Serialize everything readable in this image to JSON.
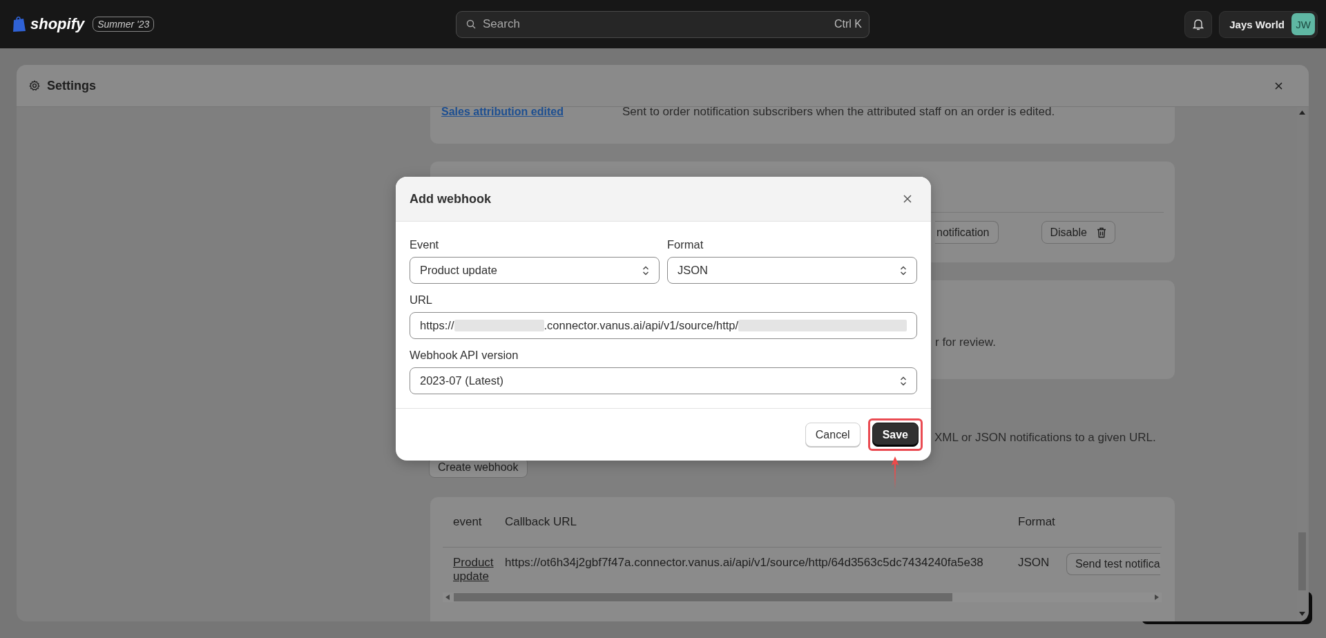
{
  "topbar": {
    "logo_text": "shopify",
    "edition_badge": "Summer '23",
    "search": {
      "placeholder": "Search",
      "shortcut": "Ctrl K"
    },
    "store": {
      "name": "Jays World",
      "initials": "JW"
    }
  },
  "settings": {
    "title": "Settings"
  },
  "background": {
    "subscription": {
      "event": "Sales attribution edited",
      "description": "Sent to order notification subscribers when the attributed staff on an order is edited."
    },
    "test_button": "notification",
    "disable_button": "Disable",
    "review_text": "r for review.",
    "webhooks_text": "XML or JSON notifications to a given URL.",
    "create_button": "Create webhook",
    "table": {
      "columns": [
        "event",
        "Callback URL",
        "Format"
      ],
      "rows": [
        {
          "event": "Product update",
          "url": "https://ot6h34j2gbf7f47a.connector.vanus.ai/api/v1/source/http/64d3563c5dc7434240fa5e38",
          "format": "JSON",
          "action": "Send test notifica"
        }
      ]
    }
  },
  "dialog": {
    "title": "Add webhook",
    "rows": [
      [
        {
          "kind": "select",
          "label": "Event",
          "value": "Product update"
        },
        {
          "kind": "select",
          "label": "Format",
          "value": "JSON"
        }
      ],
      [
        {
          "kind": "url",
          "label": "URL",
          "segments": [
            {
              "kind": "text",
              "text": "https://"
            },
            {
              "kind": "redacted"
            },
            {
              "kind": "text",
              "text": ".connector.vanus.ai/api/v1/source/http/"
            },
            {
              "kind": "redacted"
            }
          ]
        }
      ],
      [
        {
          "kind": "select",
          "label": "Webhook API version",
          "value": "2023-07 (Latest)"
        }
      ]
    ],
    "buttons": [
      {
        "label": "Cancel",
        "primary": false,
        "highlighted": false
      },
      {
        "label": "Save",
        "primary": true,
        "highlighted": true
      }
    ]
  }
}
